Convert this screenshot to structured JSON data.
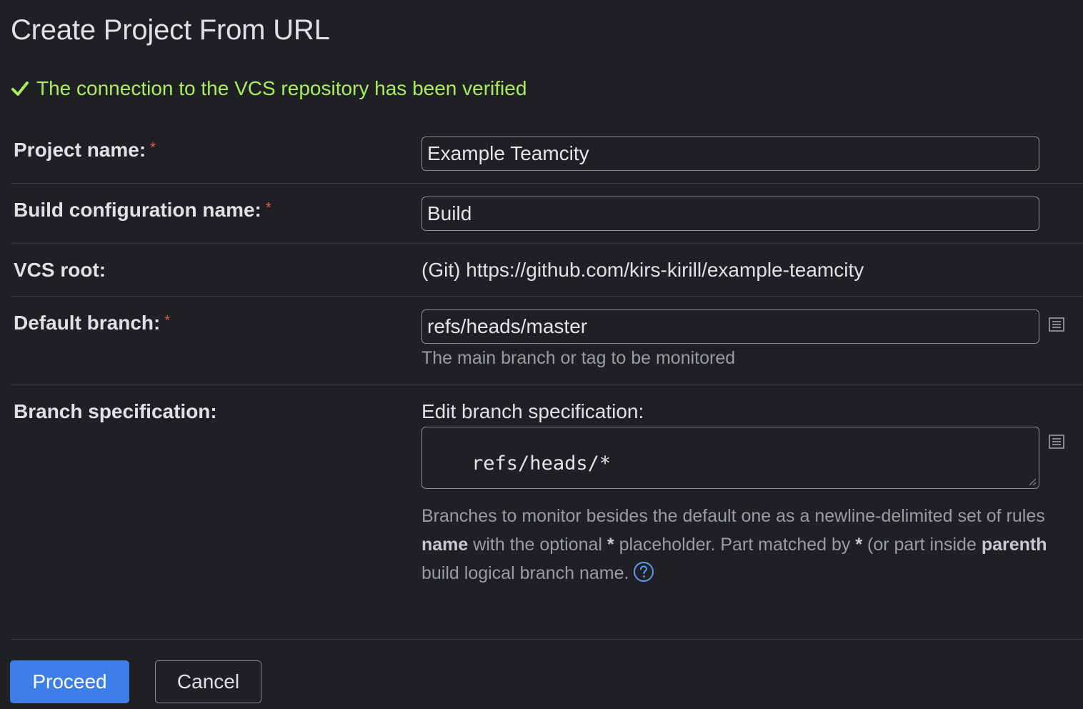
{
  "page": {
    "title": "Create Project From URL",
    "verified_message": "The connection to the VCS repository has been verified"
  },
  "colors": {
    "background": "#1f2023",
    "success": "#a9ec5e",
    "required": "#e25a5a",
    "primary": "#3e7ee8"
  },
  "form": {
    "project_name": {
      "label": "Project name:",
      "required_mark": "*",
      "value": "Example Teamcity"
    },
    "build_config_name": {
      "label": "Build configuration name:",
      "required_mark": "*",
      "value": "Build"
    },
    "vcs_root": {
      "label": "VCS root:",
      "value": "(Git) https://github.com/kirs-kirill/example-teamcity"
    },
    "default_branch": {
      "label": "Default branch:",
      "required_mark": "*",
      "value": "refs/heads/master",
      "hint": "The main branch or tag to be monitored"
    },
    "branch_spec": {
      "label": "Branch specification:",
      "edit_label": "Edit branch specification:",
      "value": "refs/heads/*",
      "desc_1": "Branches to monitor besides the default one as a newline-delimited set of rules",
      "desc_2_bold_a": "name",
      "desc_2_a": " with the optional ",
      "desc_2_star1": "*",
      "desc_2_b": " placeholder. Part matched by ",
      "desc_2_star2": "*",
      "desc_2_c": " (or part inside ",
      "desc_2_bold_b": "parenth",
      "desc_3": "build logical branch name."
    }
  },
  "buttons": {
    "proceed": "Proceed",
    "cancel": "Cancel"
  },
  "icons": {
    "verified": "checkmark-icon",
    "list": "list-icon",
    "help": "help-circle-icon"
  }
}
